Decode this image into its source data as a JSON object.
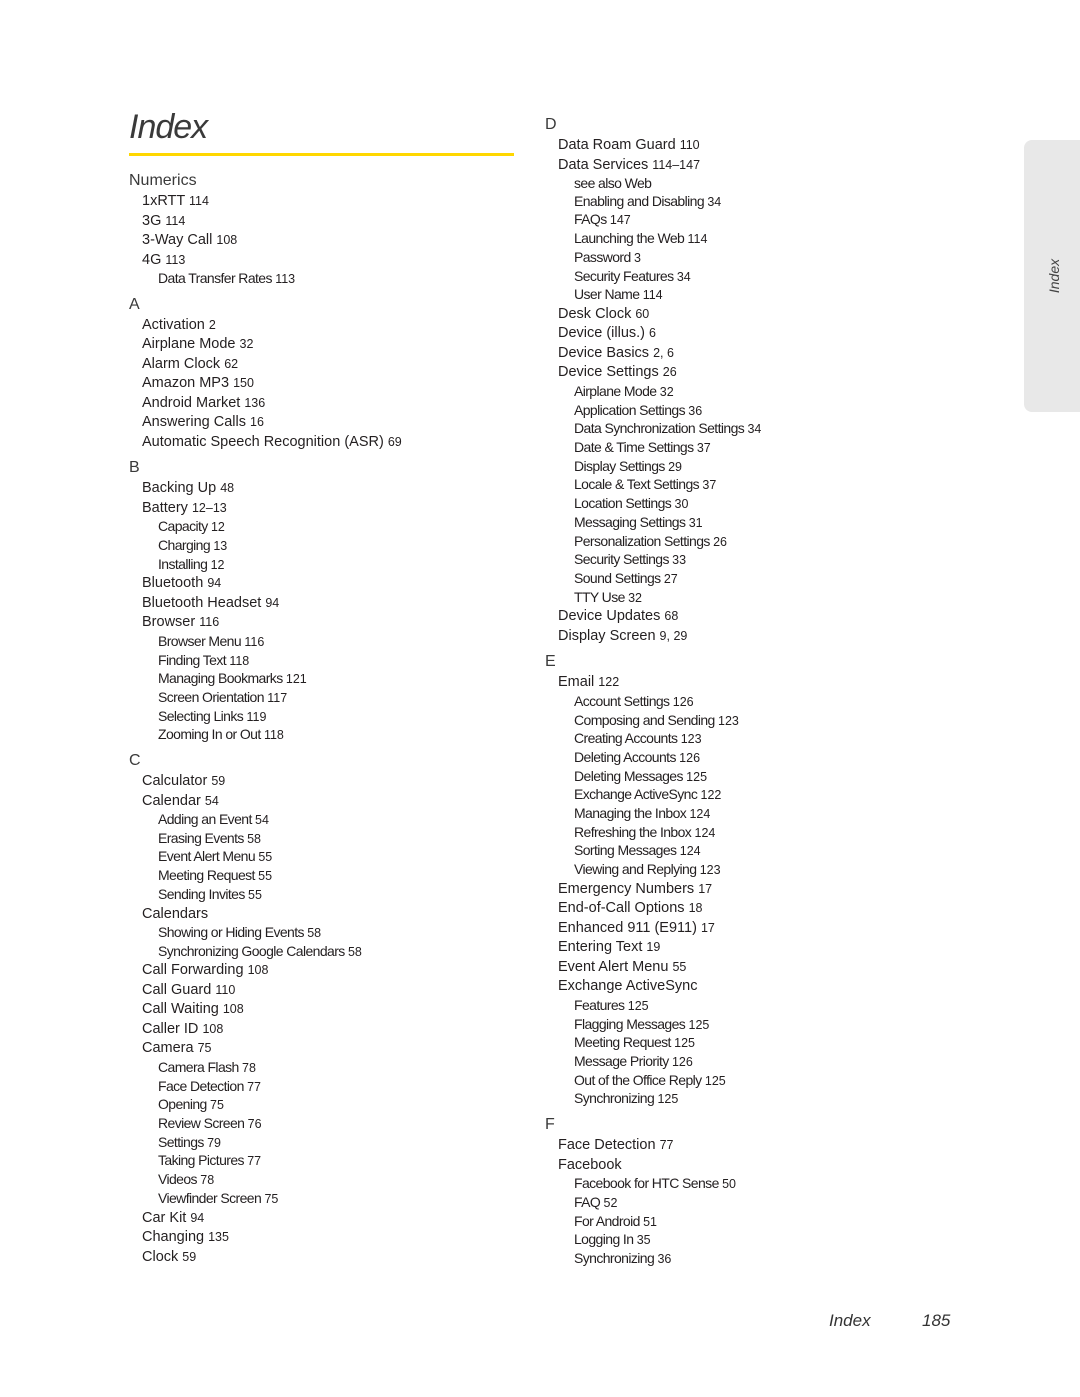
{
  "page": {
    "title": "Index",
    "side_tab": "Index",
    "footer_label": "Index",
    "footer_page_number": "185",
    "accent_color": "#ffd700"
  },
  "left_column": [
    {
      "heading": "Numerics",
      "entries": [
        {
          "level": 1,
          "term": "1xRTT",
          "pages": "114"
        },
        {
          "level": 1,
          "term": "3G",
          "pages": "114"
        },
        {
          "level": 1,
          "term": "3-Way Call",
          "pages": "108"
        },
        {
          "level": 1,
          "term": "4G",
          "pages": "113"
        },
        {
          "level": 2,
          "term": "Data Transfer Rates",
          "pages": "113"
        }
      ]
    },
    {
      "heading": "A",
      "entries": [
        {
          "level": 1,
          "term": "Activation",
          "pages": "2"
        },
        {
          "level": 1,
          "term": "Airplane Mode",
          "pages": "32"
        },
        {
          "level": 1,
          "term": "Alarm Clock",
          "pages": "62"
        },
        {
          "level": 1,
          "term": "Amazon MP3",
          "pages": "150"
        },
        {
          "level": 1,
          "term": "Android Market",
          "pages": "136"
        },
        {
          "level": 1,
          "term": "Answering Calls",
          "pages": "16"
        },
        {
          "level": 1,
          "term": "Automatic Speech Recognition (ASR)",
          "pages": "69"
        }
      ]
    },
    {
      "heading": "B",
      "entries": [
        {
          "level": 1,
          "term": "Backing Up",
          "pages": "48"
        },
        {
          "level": 1,
          "term": "Battery",
          "pages": "12–13"
        },
        {
          "level": 2,
          "term": "Capacity",
          "pages": "12"
        },
        {
          "level": 2,
          "term": "Charging",
          "pages": "13"
        },
        {
          "level": 2,
          "term": "Installing",
          "pages": "12"
        },
        {
          "level": 1,
          "term": "Bluetooth",
          "pages": "94"
        },
        {
          "level": 1,
          "term": "Bluetooth Headset",
          "pages": "94"
        },
        {
          "level": 1,
          "term": "Browser",
          "pages": "116"
        },
        {
          "level": 2,
          "term": "Browser Menu",
          "pages": "116"
        },
        {
          "level": 2,
          "term": "Finding Text",
          "pages": "118"
        },
        {
          "level": 2,
          "term": "Managing Bookmarks",
          "pages": "121"
        },
        {
          "level": 2,
          "term": "Screen Orientation",
          "pages": "117"
        },
        {
          "level": 2,
          "term": "Selecting Links",
          "pages": "119"
        },
        {
          "level": 2,
          "term": "Zooming In or Out",
          "pages": "118"
        }
      ]
    },
    {
      "heading": "C",
      "entries": [
        {
          "level": 1,
          "term": "Calculator",
          "pages": "59"
        },
        {
          "level": 1,
          "term": "Calendar",
          "pages": "54"
        },
        {
          "level": 2,
          "term": "Adding an Event",
          "pages": "54"
        },
        {
          "level": 2,
          "term": "Erasing Events",
          "pages": "58"
        },
        {
          "level": 2,
          "term": "Event Alert Menu",
          "pages": "55"
        },
        {
          "level": 2,
          "term": "Meeting Request",
          "pages": "55"
        },
        {
          "level": 2,
          "term": "Sending Invites",
          "pages": "55"
        },
        {
          "level": 1,
          "term": "Calendars",
          "pages": ""
        },
        {
          "level": 2,
          "term": "Showing or Hiding Events",
          "pages": "58"
        },
        {
          "level": 2,
          "term": "Synchronizing Google Calendars",
          "pages": "58"
        },
        {
          "level": 1,
          "term": "Call Forwarding",
          "pages": "108"
        },
        {
          "level": 1,
          "term": "Call Guard",
          "pages": "110"
        },
        {
          "level": 1,
          "term": "Call Waiting",
          "pages": "108"
        },
        {
          "level": 1,
          "term": "Caller ID",
          "pages": "108"
        },
        {
          "level": 1,
          "term": "Camera",
          "pages": "75"
        },
        {
          "level": 2,
          "term": "Camera Flash",
          "pages": "78"
        },
        {
          "level": 2,
          "term": "Face Detection",
          "pages": "77"
        },
        {
          "level": 2,
          "term": "Opening",
          "pages": "75"
        },
        {
          "level": 2,
          "term": "Review Screen",
          "pages": "76"
        },
        {
          "level": 2,
          "term": "Settings",
          "pages": "79"
        },
        {
          "level": 2,
          "term": "Taking Pictures",
          "pages": "77"
        },
        {
          "level": 2,
          "term": "Videos",
          "pages": "78"
        },
        {
          "level": 2,
          "term": "Viewfinder Screen",
          "pages": "75"
        },
        {
          "level": 1,
          "term": "Car Kit",
          "pages": "94"
        },
        {
          "level": 1,
          "term": "Changing",
          "pages": "135"
        },
        {
          "level": 1,
          "term": "Clock",
          "pages": "59"
        }
      ]
    }
  ],
  "right_column": [
    {
      "heading": "D",
      "entries": [
        {
          "level": 1,
          "term": "Data Roam Guard",
          "pages": "110"
        },
        {
          "level": 1,
          "term": "Data Services",
          "pages": "114–147"
        },
        {
          "level": 2,
          "term": "see also Web",
          "pages": ""
        },
        {
          "level": 2,
          "term": "Enabling and Disabling",
          "pages": "34"
        },
        {
          "level": 2,
          "term": "FAQs",
          "pages": "147"
        },
        {
          "level": 2,
          "term": "Launching the Web",
          "pages": "114"
        },
        {
          "level": 2,
          "term": "Password",
          "pages": "3"
        },
        {
          "level": 2,
          "term": "Security Features",
          "pages": "34"
        },
        {
          "level": 2,
          "term": "User Name",
          "pages": "114"
        },
        {
          "level": 1,
          "term": "Desk Clock",
          "pages": "60"
        },
        {
          "level": 1,
          "term": "Device (illus.)",
          "pages": "6"
        },
        {
          "level": 1,
          "term": "Device Basics",
          "pages": "2, 6"
        },
        {
          "level": 1,
          "term": "Device Settings",
          "pages": "26"
        },
        {
          "level": 2,
          "term": "Airplane Mode",
          "pages": "32"
        },
        {
          "level": 2,
          "term": "Application Settings",
          "pages": "36"
        },
        {
          "level": 2,
          "term": "Data Synchronization Settings",
          "pages": "34"
        },
        {
          "level": 2,
          "term": "Date & Time Settings",
          "pages": "37"
        },
        {
          "level": 2,
          "term": "Display Settings",
          "pages": "29"
        },
        {
          "level": 2,
          "term": "Locale & Text Settings",
          "pages": "37"
        },
        {
          "level": 2,
          "term": "Location Settings",
          "pages": "30"
        },
        {
          "level": 2,
          "term": "Messaging Settings",
          "pages": "31"
        },
        {
          "level": 2,
          "term": "Personalization Settings",
          "pages": "26"
        },
        {
          "level": 2,
          "term": "Security Settings",
          "pages": "33"
        },
        {
          "level": 2,
          "term": "Sound Settings",
          "pages": "27"
        },
        {
          "level": 2,
          "term": "TTY Use",
          "pages": "32"
        },
        {
          "level": 1,
          "term": "Device Updates",
          "pages": "68"
        },
        {
          "level": 1,
          "term": "Display Screen",
          "pages": "9, 29"
        }
      ]
    },
    {
      "heading": "E",
      "entries": [
        {
          "level": 1,
          "term": "Email",
          "pages": "122"
        },
        {
          "level": 2,
          "term": "Account Settings",
          "pages": "126"
        },
        {
          "level": 2,
          "term": "Composing and Sending",
          "pages": "123"
        },
        {
          "level": 2,
          "term": "Creating Accounts",
          "pages": "123"
        },
        {
          "level": 2,
          "term": "Deleting Accounts",
          "pages": "126"
        },
        {
          "level": 2,
          "term": "Deleting Messages",
          "pages": "125"
        },
        {
          "level": 2,
          "term": "Exchange ActiveSync",
          "pages": "122"
        },
        {
          "level": 2,
          "term": "Managing the Inbox",
          "pages": "124"
        },
        {
          "level": 2,
          "term": "Refreshing the Inbox",
          "pages": "124"
        },
        {
          "level": 2,
          "term": "Sorting Messages",
          "pages": "124"
        },
        {
          "level": 2,
          "term": "Viewing and Replying",
          "pages": "123"
        },
        {
          "level": 1,
          "term": "Emergency Numbers",
          "pages": "17"
        },
        {
          "level": 1,
          "term": "End-of-Call Options",
          "pages": "18"
        },
        {
          "level": 1,
          "term": "Enhanced 911 (E911)",
          "pages": "17"
        },
        {
          "level": 1,
          "term": "Entering Text",
          "pages": "19"
        },
        {
          "level": 1,
          "term": "Event Alert Menu",
          "pages": "55"
        },
        {
          "level": 1,
          "term": "Exchange ActiveSync",
          "pages": ""
        },
        {
          "level": 2,
          "term": "Features",
          "pages": "125"
        },
        {
          "level": 2,
          "term": "Flagging Messages",
          "pages": "125"
        },
        {
          "level": 2,
          "term": "Meeting Request",
          "pages": "125"
        },
        {
          "level": 2,
          "term": "Message Priority",
          "pages": "126"
        },
        {
          "level": 2,
          "term": "Out of the Office Reply",
          "pages": "125"
        },
        {
          "level": 2,
          "term": "Synchronizing",
          "pages": "125"
        }
      ]
    },
    {
      "heading": "F",
      "entries": [
        {
          "level": 1,
          "term": "Face Detection",
          "pages": "77"
        },
        {
          "level": 1,
          "term": "Facebook",
          "pages": ""
        },
        {
          "level": 2,
          "term": "Facebook for HTC Sense",
          "pages": "50"
        },
        {
          "level": 2,
          "term": "FAQ",
          "pages": "52"
        },
        {
          "level": 2,
          "term": "For Android",
          "pages": "51"
        },
        {
          "level": 2,
          "term": "Logging In",
          "pages": "35"
        },
        {
          "level": 2,
          "term": "Synchronizing",
          "pages": "36"
        }
      ]
    }
  ]
}
